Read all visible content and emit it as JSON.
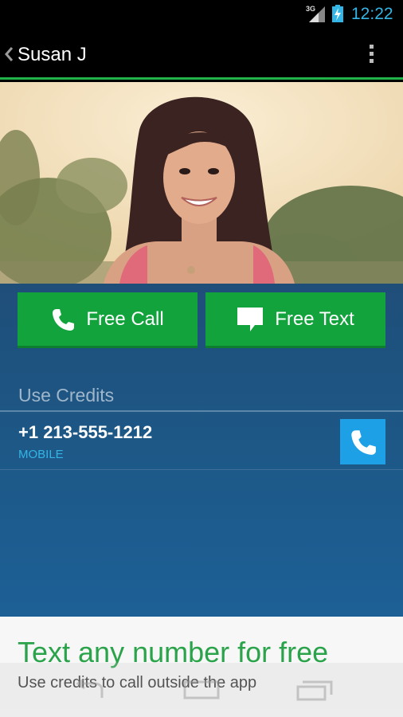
{
  "status_bar": {
    "network": "3G",
    "time": "12:22",
    "accent": "#33b5e5"
  },
  "action_bar": {
    "title": "Susan J",
    "back_icon": "chevron-left-icon",
    "overflow_icon": "overflow-menu-icon",
    "accent_line": "#21b34a"
  },
  "actions": {
    "free_call_label": "Free Call",
    "free_text_label": "Free Text",
    "button_color": "#13a33d"
  },
  "credits": {
    "section_label": "Use Credits",
    "phone_number": "+1 213-555-1212",
    "phone_type": "MOBILE",
    "call_button_color": "#1ea0e6"
  },
  "promo": {
    "title": "Text any number for free",
    "subtitle": "Use credits to call outside the app",
    "title_color": "#2aa34b"
  }
}
